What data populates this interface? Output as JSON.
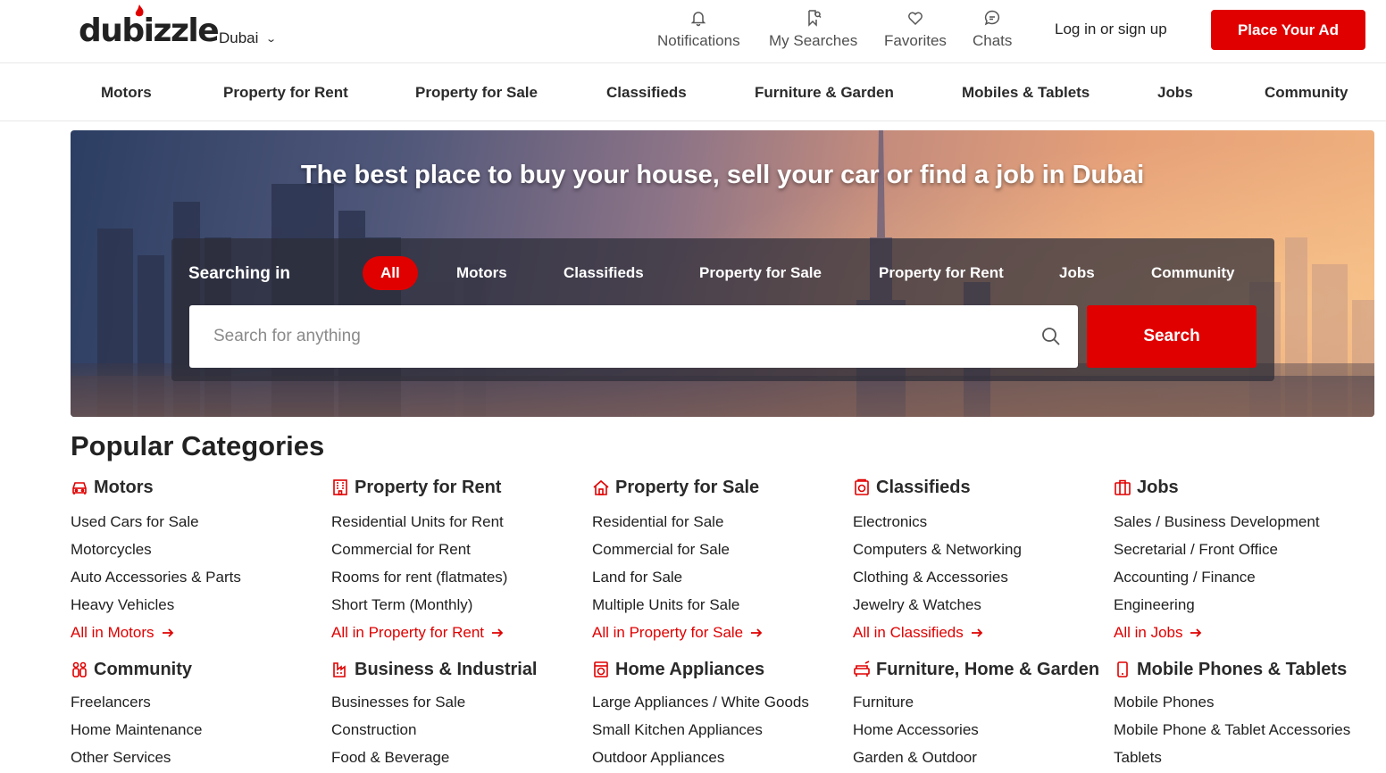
{
  "header": {
    "logo": "dubizzle",
    "city": "Dubai",
    "nav": [
      {
        "label": "Notifications",
        "icon": "bell-icon"
      },
      {
        "label": "My Searches",
        "icon": "bookmark-search-icon"
      },
      {
        "label": "Favorites",
        "icon": "heart-icon"
      },
      {
        "label": "Chats",
        "icon": "chat-bubble-icon"
      }
    ],
    "login_label": "Log in or sign up",
    "place_ad_label": "Place Your Ad"
  },
  "category_bar": [
    "Motors",
    "Property for Rent",
    "Property for Sale",
    "Classifieds",
    "Furniture & Garden",
    "Mobiles & Tablets",
    "Jobs",
    "Community"
  ],
  "hero": {
    "title": "The best place to buy your house, sell your car or find a job in Dubai",
    "searching_in_label": "Searching in",
    "tabs": [
      "All",
      "Motors",
      "Classifieds",
      "Property for Sale",
      "Property for Rent",
      "Jobs",
      "Community"
    ],
    "active_tab": "All",
    "search_placeholder": "Search for anything",
    "search_button_label": "Search"
  },
  "popular": {
    "title": "Popular Categories",
    "columns_row1": [
      {
        "name": "Motors",
        "icon": "car-icon",
        "links": [
          "Used Cars for Sale",
          "Motorcycles",
          "Auto Accessories & Parts",
          "Heavy Vehicles"
        ],
        "all_label": "All in Motors"
      },
      {
        "name": "Property for Rent",
        "icon": "building-icon",
        "links": [
          "Residential Units for Rent",
          "Commercial for Rent",
          "Rooms for rent (flatmates)",
          "Short Term (Monthly)"
        ],
        "all_label": "All in Property for Rent"
      },
      {
        "name": "Property for Sale",
        "icon": "house-icon",
        "links": [
          "Residential for Sale",
          "Commercial for Sale",
          "Land for Sale",
          "Multiple Units for Sale"
        ],
        "all_label": "All in Property for Sale"
      },
      {
        "name": "Classifieds",
        "icon": "classifieds-icon",
        "links": [
          "Electronics",
          "Computers & Networking",
          "Clothing & Accessories",
          "Jewelry & Watches"
        ],
        "all_label": "All in Classifieds"
      },
      {
        "name": "Jobs",
        "icon": "briefcase-icon",
        "links": [
          "Sales / Business Development",
          "Secretarial / Front Office",
          "Accounting / Finance",
          "Engineering"
        ],
        "all_label": "All in Jobs"
      }
    ],
    "columns_row2": [
      {
        "name": "Community",
        "icon": "people-icon",
        "links": [
          "Freelancers",
          "Home Maintenance",
          "Other Services"
        ]
      },
      {
        "name": "Business & Industrial",
        "icon": "factory-icon",
        "links": [
          "Businesses for Sale",
          "Construction",
          "Food & Beverage"
        ]
      },
      {
        "name": "Home Appliances",
        "icon": "washing-machine-icon",
        "links": [
          "Large Appliances / White Goods",
          "Small Kitchen Appliances",
          "Outdoor Appliances"
        ]
      },
      {
        "name": "Furniture, Home & Garden",
        "icon": "sofa-icon",
        "links": [
          "Furniture",
          "Home Accessories",
          "Garden & Outdoor"
        ]
      },
      {
        "name": "Mobile Phones & Tablets",
        "icon": "mobile-phone-icon",
        "links": [
          "Mobile Phones",
          "Mobile Phone & Tablet Accessories",
          "Tablets"
        ]
      }
    ]
  },
  "colors": {
    "brand_red": "#e00000",
    "text": "#1f1f1f"
  }
}
